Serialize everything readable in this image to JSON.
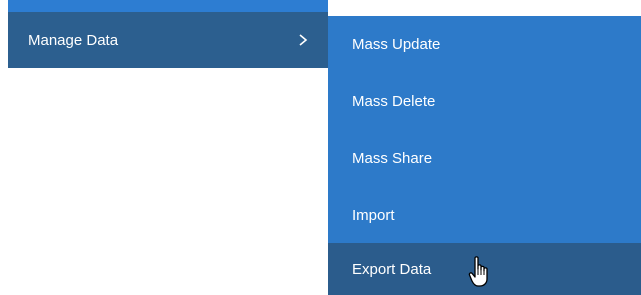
{
  "parent_menu": {
    "item_label": "Manage Data",
    "chevron_icon": "chevron-right-icon"
  },
  "submenu": {
    "items": [
      {
        "label": "Mass Update"
      },
      {
        "label": "Mass Delete"
      },
      {
        "label": "Mass Share"
      },
      {
        "label": "Import"
      },
      {
        "label": "Export Data"
      }
    ],
    "active_index": 4
  },
  "colors": {
    "parent_background": "#2c5f8f",
    "submenu_background": "#2d7ac9",
    "active_background": "#2b5c8c",
    "text": "#ffffff"
  },
  "cursor_icon": "hand-pointer-icon"
}
